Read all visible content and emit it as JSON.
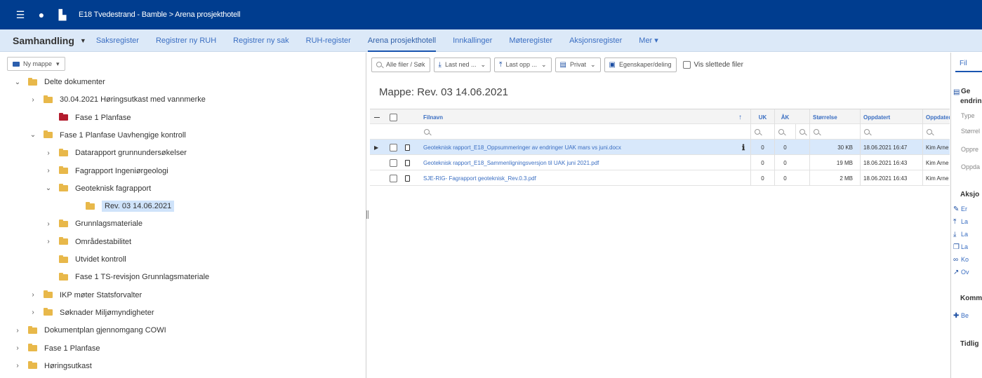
{
  "topbar": {
    "menu_icon": "☰",
    "user_icon": "●",
    "chart_icon": "▙",
    "title": "E18 Tvedestrand - Bamble > Arena prosjekthotell"
  },
  "nav": {
    "brand": "Samhandling",
    "items": [
      {
        "label": "Saksregister"
      },
      {
        "label": "Registrer ny RUH"
      },
      {
        "label": "Registrer ny sak"
      },
      {
        "label": "RUH-register"
      },
      {
        "label": "Arena prosjekthotell",
        "active": true
      },
      {
        "label": "Innkallinger"
      },
      {
        "label": "Møteregister"
      },
      {
        "label": "Aksjonsregister"
      },
      {
        "label": "Mer ▾"
      }
    ]
  },
  "left": {
    "new_folder": "Ny mappe",
    "tree": [
      {
        "label": "Delte dokumenter",
        "toggle": "⌄"
      },
      {
        "label": "30.04.2021 Høringsutkast med vannmerke",
        "toggle": "›"
      },
      {
        "label": "Fase 1 Planfase",
        "toggle": "",
        "red": true
      },
      {
        "label": "Fase 1 Planfase Uavhengige kontroll",
        "toggle": "⌄"
      },
      {
        "label": "Datarapport grunnundersøkelser",
        "toggle": "›"
      },
      {
        "label": "Fagrapport Ingeniørgeologi",
        "toggle": "›"
      },
      {
        "label": "Geoteknisk fagrapport",
        "toggle": "⌄"
      },
      {
        "label": "Rev. 03 14.06.2021",
        "toggle": "",
        "selected": true
      },
      {
        "label": "Grunnlagsmateriale",
        "toggle": "›"
      },
      {
        "label": "Områdestabilitet",
        "toggle": "›"
      },
      {
        "label": "Utvidet kontroll",
        "toggle": ""
      },
      {
        "label": "Fase 1 TS-revisjon Grunnlagsmateriale",
        "toggle": ""
      },
      {
        "label": "IKP møter Statsforvalter",
        "toggle": "›"
      },
      {
        "label": "Søknader Miljømyndigheter",
        "toggle": "›"
      },
      {
        "label": "Dokumentplan gjennomgang COWI",
        "toggle": "›"
      },
      {
        "label": "Fase 1 Planfase",
        "toggle": "›"
      },
      {
        "label": "Høringsutkast",
        "toggle": "›"
      }
    ]
  },
  "toolbar": {
    "all_files": "Alle filer / Søk",
    "download": "Last ned ...",
    "upload": "Last opp ...",
    "privacy": "Privat",
    "properties": "Egenskaper/deling",
    "show_deleted": "Vis slettede filer"
  },
  "folder_title": "Mappe: Rev. 03 14.06.2021",
  "grid": {
    "columns": {
      "filename": "Filnavn",
      "uk": "UK",
      "ak": "ÅK",
      "size": "Størrelse",
      "updated": "Oppdatert",
      "updated_by": "Oppdatert av"
    },
    "rows": [
      {
        "filename": "Geoteknisk rapport_E18_Oppsummeringer av endringer UAK mars vs juni.docx",
        "uk": "0",
        "ak": "0",
        "size": "30 KB",
        "updated": "18.06.2021 16:47",
        "by": "Kim Arne",
        "selected": true
      },
      {
        "filename": "Geoteknisk rapport_E18_Sammenligningsversjon til UAK juni 2021.pdf",
        "uk": "0",
        "ak": "0",
        "size": "19 MB",
        "updated": "18.06.2021 16:43",
        "by": "Kim Arne"
      },
      {
        "filename": "SJE-RIG- Fagrapport geoteknisk_Rev.0.3.pdf",
        "uk": "0",
        "ak": "0",
        "size": "2 MB",
        "updated": "18.06.2021 16:43",
        "by": "Kim Arne"
      }
    ]
  },
  "right": {
    "tab": "Fil",
    "file_title_1": "Ge",
    "file_title_2": "endrin",
    "props": [
      "Type",
      "Størrel",
      "Oppre",
      "Oppda"
    ],
    "actions_title": "Aksjo",
    "actions": [
      "Er",
      "La",
      "La",
      "La",
      "Ko",
      "Ov"
    ],
    "comments_title": "Komm",
    "comment_add": "Be",
    "history_title": "Tidlig"
  }
}
